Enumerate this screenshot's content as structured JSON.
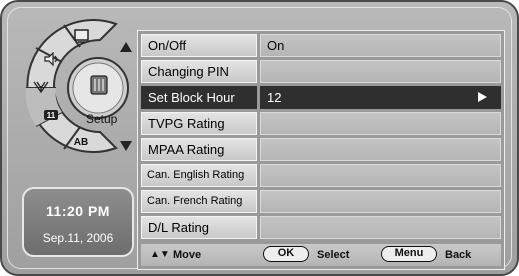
{
  "dial": {
    "center_label": "Setup",
    "icons": [
      "screen-icon",
      "speaker-icon",
      "antenna-icon",
      "parental-lock-icon",
      "language-ab-icon"
    ],
    "ab_text": "AB"
  },
  "clock": {
    "time": "11:20 PM",
    "date": "Sep.11, 2006"
  },
  "menu": {
    "rows": [
      {
        "label": "On/Off",
        "value": "On"
      },
      {
        "label": "Changing PIN",
        "value": ""
      },
      {
        "label": "Set Block Hour",
        "value": "12",
        "selected": true
      },
      {
        "label": "TVPG Rating",
        "value": ""
      },
      {
        "label": "MPAA Rating",
        "value": ""
      },
      {
        "label": "Can. English Rating",
        "value": ""
      },
      {
        "label": "Can. French Rating",
        "value": ""
      },
      {
        "label": "D/L Rating",
        "value": ""
      }
    ]
  },
  "footer": {
    "move_arrows": "▲▼",
    "move_label": "Move",
    "ok_key": "OK",
    "select_label": "Select",
    "menu_key": "Menu",
    "back_label": "Back"
  },
  "colors": {
    "frame": "#b0b0b0",
    "selected_row": "#2f2f2f",
    "row_label_bg": "#d8d8d8",
    "row_value_bg": "#bdbdbd"
  }
}
